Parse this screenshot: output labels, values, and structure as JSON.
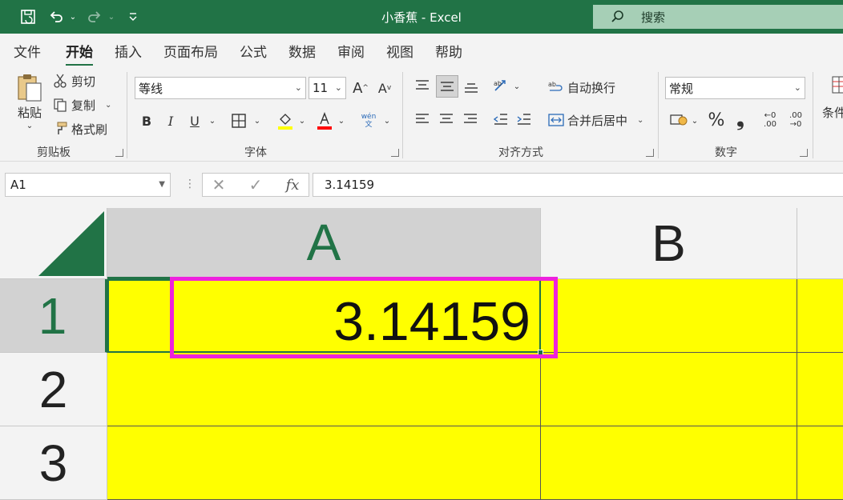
{
  "title_bar": {
    "document_title": "小香蕉 - Excel",
    "search_label": "搜索",
    "icons": [
      "autosave-icon",
      "undo-icon",
      "redo-icon",
      "customize-quick-access-icon",
      "search-icon"
    ]
  },
  "menu": {
    "tabs": [
      "文件",
      "开始",
      "插入",
      "页面布局",
      "公式",
      "数据",
      "审阅",
      "视图",
      "帮助"
    ],
    "active_tab": "开始"
  },
  "ribbon": {
    "clipboard": {
      "paste_label": "粘贴",
      "cut_label": "剪切",
      "copy_label": "复制",
      "format_painter_label": "格式刷",
      "group_label": "剪贴板"
    },
    "font": {
      "font_name": "等线",
      "font_size": "11",
      "bold": "B",
      "italic": "I",
      "underline": "U",
      "phonetic_label": "wén\n文",
      "group_label": "字体",
      "fill_color": "#ffff00",
      "font_color": "#ff0000"
    },
    "alignment": {
      "wrap_text_label": "自动换行",
      "merge_center_label": "合并后居中",
      "group_label": "对齐方式"
    },
    "number": {
      "format": "常规",
      "percent_symbol": "%",
      "comma_symbol": "❟",
      "increase_decimal": "←0\n.00",
      "decrease_decimal": ".00\n→0",
      "group_label": "数字"
    },
    "conditional_format_label": "条件"
  },
  "formula_bar": {
    "name_box": "A1",
    "formula": "3.14159"
  },
  "sheet": {
    "columns": [
      "A",
      "B"
    ],
    "rows": [
      "1",
      "2",
      "3"
    ],
    "selected_cell": "A1",
    "cells": {
      "A1": "3.14159"
    },
    "cell_fill_color": "#ffff00",
    "highlight_color": "#ee22dd"
  },
  "colors": {
    "brand": "#217346",
    "ribbon_background": "#f3f3f3"
  }
}
